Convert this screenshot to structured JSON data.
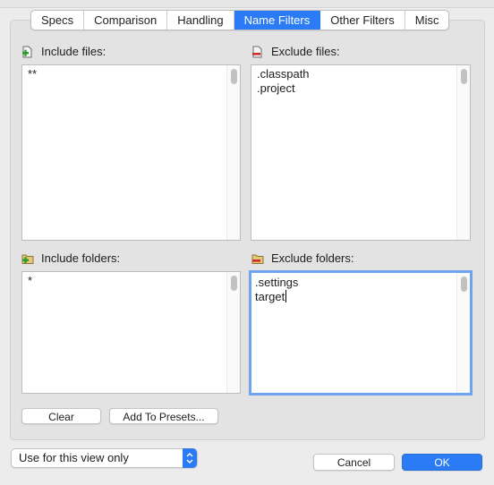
{
  "tabs": [
    {
      "label": "Specs",
      "active": false
    },
    {
      "label": "Comparison",
      "active": false
    },
    {
      "label": "Handling",
      "active": false
    },
    {
      "label": "Name Filters",
      "active": true
    },
    {
      "label": "Other Filters",
      "active": false
    },
    {
      "label": "Misc",
      "active": false
    }
  ],
  "include_files": {
    "label": "Include files:",
    "icon": "file-add-icon",
    "lines": [
      "**"
    ]
  },
  "exclude_files": {
    "label": "Exclude files:",
    "icon": "file-remove-icon",
    "lines": [
      ".classpath",
      ".project"
    ]
  },
  "include_folders": {
    "label": "Include folders:",
    "icon": "folder-add-icon",
    "lines": [
      "*"
    ]
  },
  "exclude_folders": {
    "label": "Exclude folders:",
    "icon": "folder-remove-icon",
    "lines": [
      ".settings",
      "target"
    ]
  },
  "buttons": {
    "clear": "Clear",
    "add_to_presets": "Add To Presets...",
    "cancel": "Cancel",
    "ok": "OK"
  },
  "scope_select": {
    "value": "Use for this view only"
  },
  "colors": {
    "accent": "#2a7bf5",
    "focus_ring": "#6ea4ef"
  }
}
